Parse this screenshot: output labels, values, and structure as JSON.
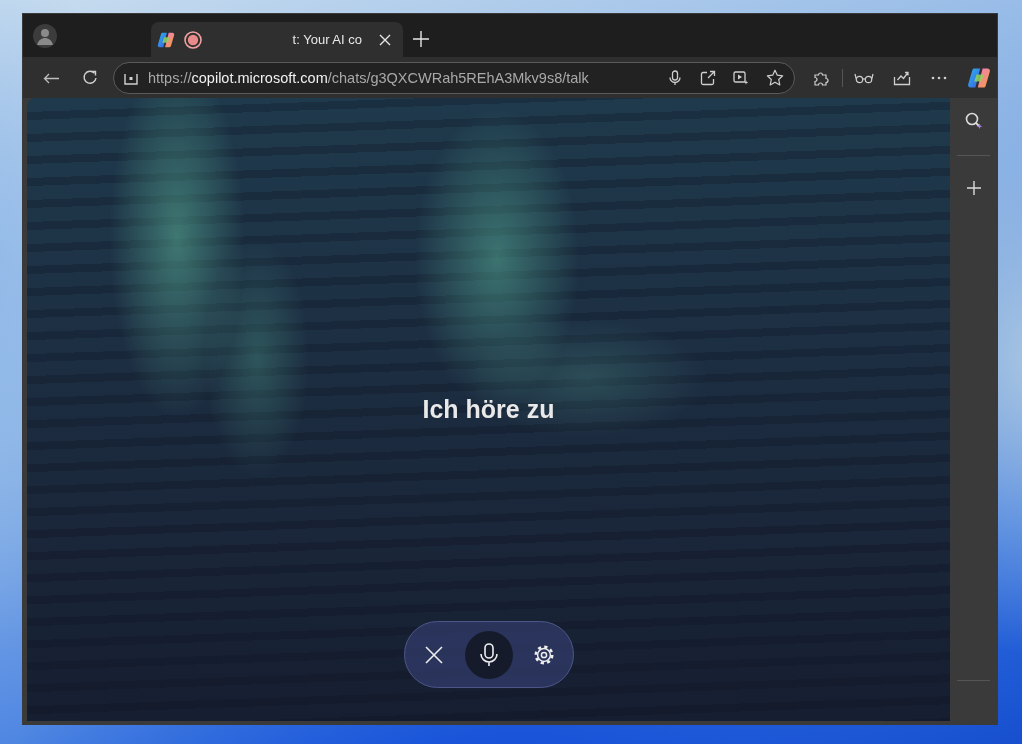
{
  "tabs": [
    {
      "title": "t: Your AI co",
      "selected": true,
      "recording": true
    }
  ],
  "address_bar": {
    "url": "https://**copilot.microsoft.com**/chats/g3QXCWRah5REhA3Mkv9s8/talk"
  },
  "content": {
    "status_text": "Ich höre zu"
  },
  "voice_controls": {
    "microphone_on": true
  }
}
